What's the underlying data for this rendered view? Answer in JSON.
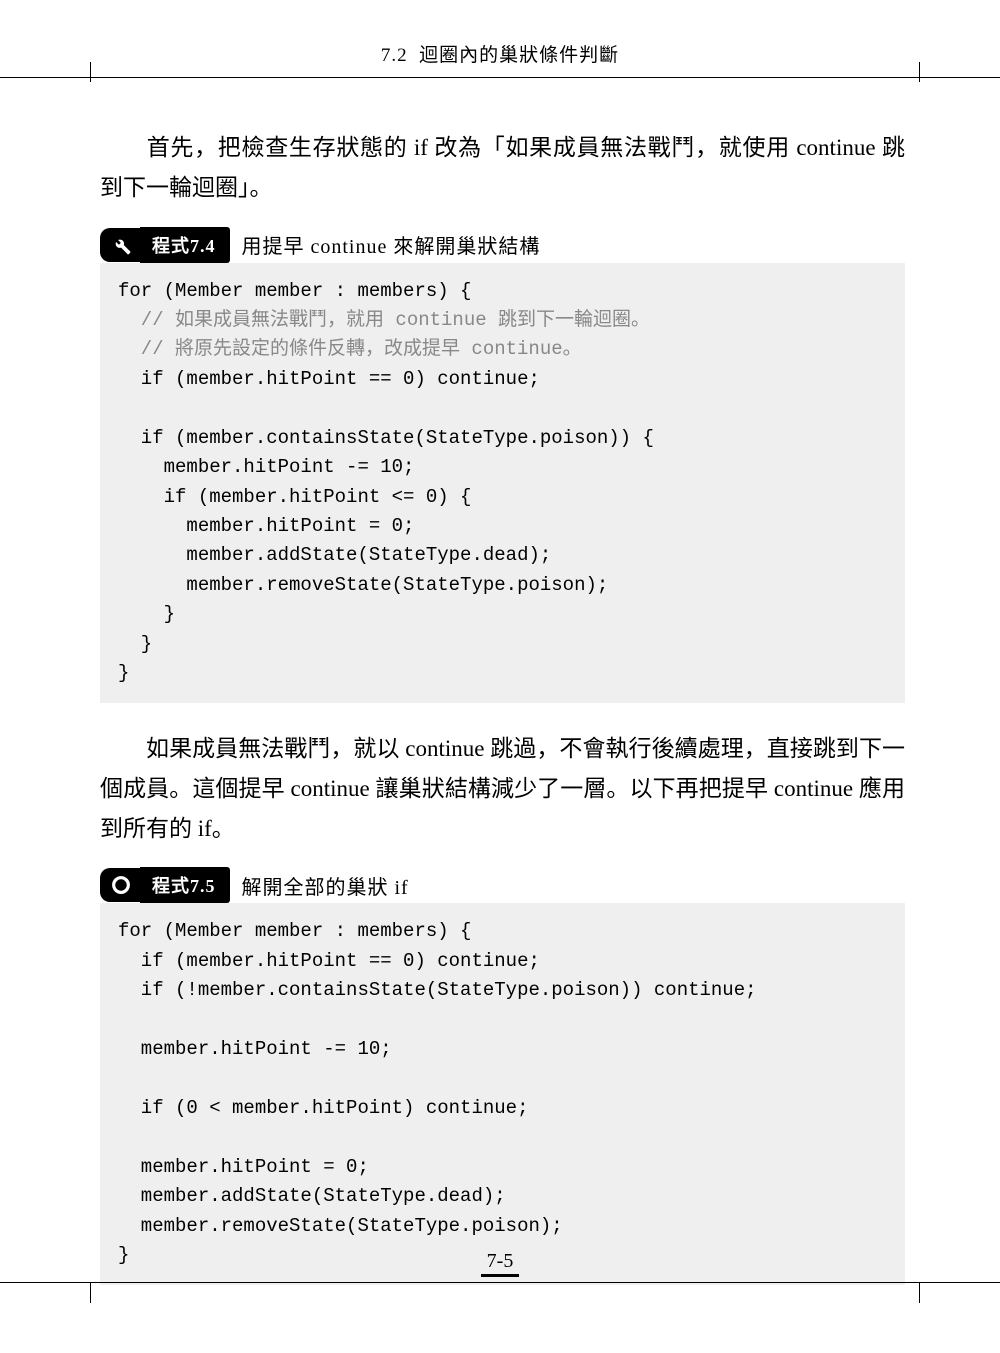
{
  "header": {
    "section": "7.2",
    "title": "迴圈內的巢狀條件判斷"
  },
  "para1": "首先，把檢查生存狀態的 if 改為「如果成員無法戰鬥，就使用 continue 跳到下一輪迴圈」。",
  "listing1": {
    "label": "程式7.4",
    "title": "用提早 continue 來解開巢狀結構",
    "code_line1": "for (Member member : members) {",
    "code_c1": "  // 如果成員無法戰鬥，就用 continue 跳到下一輪迴圈。",
    "code_c2": "  // 將原先設定的條件反轉，改成提早 continue。",
    "code_line2": "  if (member.hitPoint == 0) continue;",
    "code_blank1": "",
    "code_line3": "  if (member.containsState(StateType.poison)) {",
    "code_line4": "    member.hitPoint -= 10;",
    "code_line5": "    if (member.hitPoint <= 0) {",
    "code_line6": "      member.hitPoint = 0;",
    "code_line7": "      member.addState(StateType.dead);",
    "code_line8": "      member.removeState(StateType.poison);",
    "code_line9": "    }",
    "code_line10": "  }",
    "code_line11": "}"
  },
  "para2": "如果成員無法戰鬥，就以 continue 跳過，不會執行後續處理，直接跳到下一個成員。這個提早 continue 讓巢狀結構減少了一層。以下再把提早 continue 應用到所有的 if。",
  "listing2": {
    "label": "程式7.5",
    "title": "解開全部的巢狀 if",
    "code_line1": "for (Member member : members) {",
    "code_line2": "  if (member.hitPoint == 0) continue;",
    "code_line3": "  if (!member.containsState(StateType.poison)) continue;",
    "code_blank1": "",
    "code_line4": "  member.hitPoint -= 10;",
    "code_blank2": "",
    "code_line5": "  if (0 < member.hitPoint) continue;",
    "code_blank3": "",
    "code_line6": "  member.hitPoint = 0;",
    "code_line7": "  member.addState(StateType.dead);",
    "code_line8": "  member.removeState(StateType.poison);",
    "code_line9": "}"
  },
  "page_number": "7-5"
}
